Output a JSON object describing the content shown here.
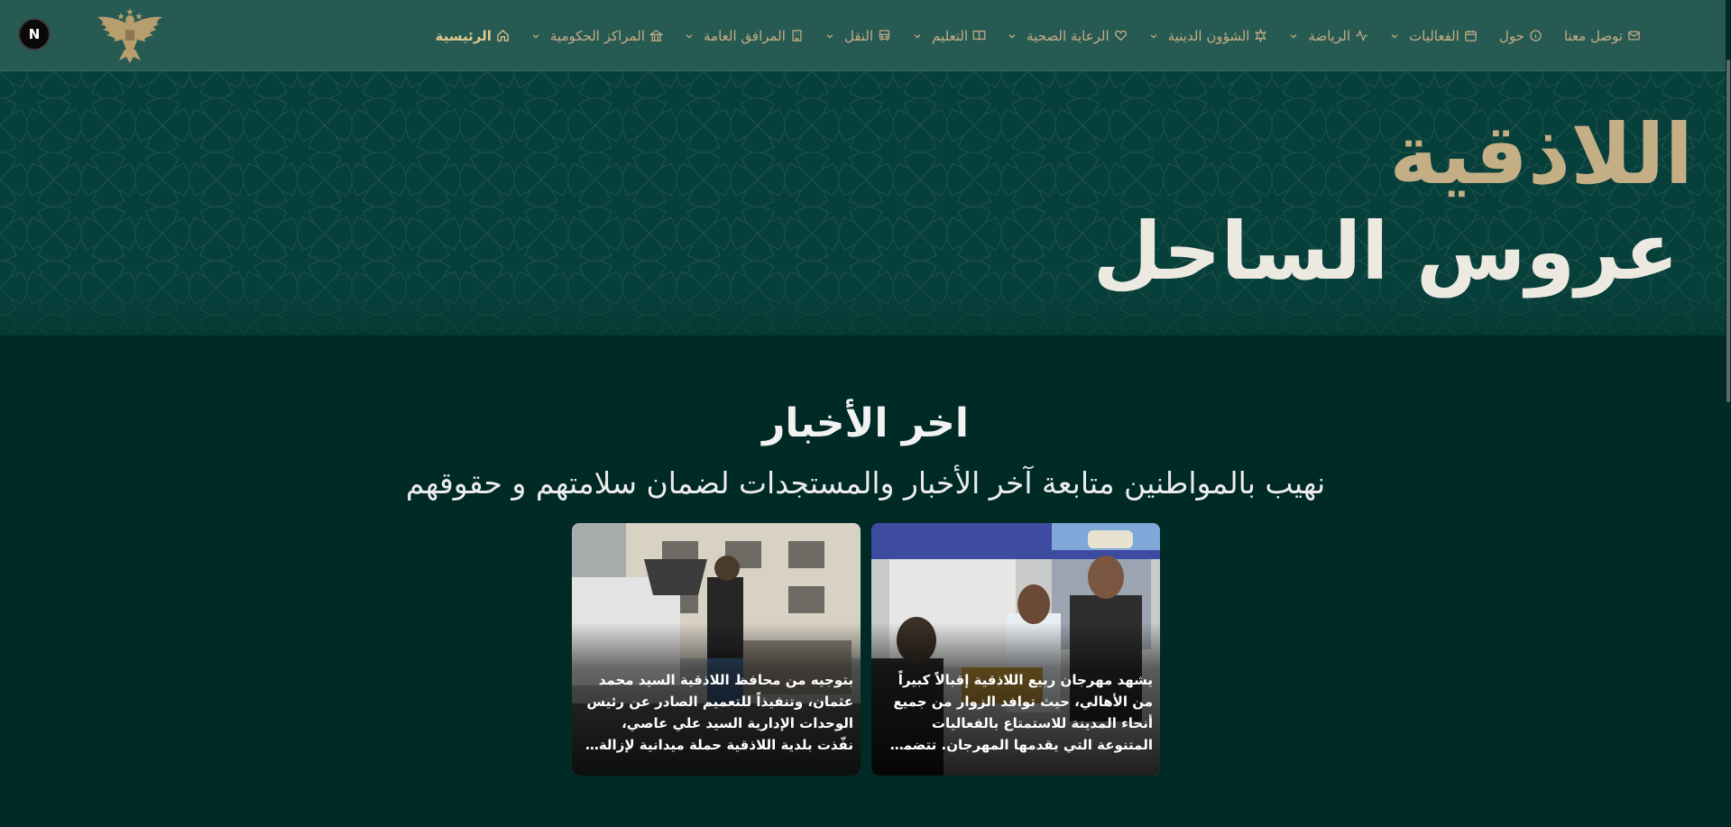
{
  "nav": {
    "badge": "N",
    "items": [
      {
        "label": "الرئيسية",
        "icon": "home-icon",
        "dropdown": false,
        "active": true
      },
      {
        "label": "المراكز الحكومية",
        "icon": "landmark-icon",
        "dropdown": true,
        "active": false
      },
      {
        "label": "المرافق العامة",
        "icon": "building-icon",
        "dropdown": true,
        "active": false
      },
      {
        "label": "النقل",
        "icon": "bus-icon",
        "dropdown": true,
        "active": false
      },
      {
        "label": "التعليم",
        "icon": "book-icon",
        "dropdown": true,
        "active": false
      },
      {
        "label": "الرعاية الصحية",
        "icon": "heart-icon",
        "dropdown": true,
        "active": false
      },
      {
        "label": "الشؤون الدينية",
        "icon": "star-icon",
        "dropdown": true,
        "active": false
      },
      {
        "label": "الرياضة",
        "icon": "activity-icon",
        "dropdown": true,
        "active": false
      },
      {
        "label": "الفعاليات",
        "icon": "calendar-icon",
        "dropdown": true,
        "active": false
      },
      {
        "label": "حول",
        "icon": "info-icon",
        "dropdown": false,
        "active": false
      },
      {
        "label": "توصل معنا",
        "icon": "mail-icon",
        "dropdown": false,
        "active": false
      }
    ]
  },
  "hero": {
    "title": "اللاذقية",
    "subtitle": "عروس الساحل"
  },
  "news": {
    "title": "اخر الأخبار",
    "subtitle": "نهيب بالمواطنين متابعة آخر الأخبار والمستجدات لضمان سلامتهم و حقوقهم",
    "cards": [
      {
        "text": "يشهد مهرجان ربيع اللاذقية إقبالاً كبيراً من الأهالي، حيث توافد الزوار من جميع أنحاء المدينة للاستمتاع بالفعاليات المتنوعة التي يقدمها المهرجان. تتضمن الفعالية عروضاً..."
      },
      {
        "text": "بتوجيه من محافظ اللاذقية السيد محمد عثمان، وتنفيذاً للتعميم الصادر عن رئيس الوحدات الإدارية السيد علي عاصي، نفّذت بلدية اللاذقية حملة ميدانية لإزالة الإشغالا..."
      }
    ]
  },
  "colors": {
    "nav_bg": "#275a53",
    "page_bg": "#002a25",
    "accent_gold": "#c4ae86"
  }
}
